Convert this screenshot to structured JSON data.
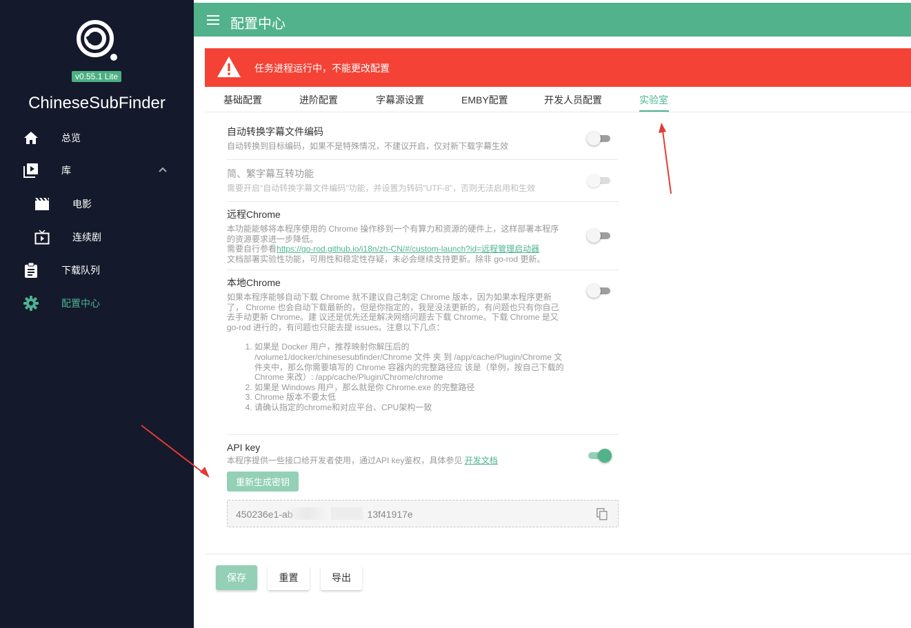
{
  "sidebar": {
    "version": "v0.55.1 Lite",
    "app_name": "ChineseSubFinder",
    "items": [
      {
        "label": "总览",
        "icon": "home-icon"
      },
      {
        "label": "库",
        "icon": "library-icon"
      },
      {
        "label": "电影",
        "icon": "movie-icon"
      },
      {
        "label": "连续剧",
        "icon": "tv-icon"
      },
      {
        "label": "下载队列",
        "icon": "clipboard-icon"
      },
      {
        "label": "配置中心",
        "icon": "gear-icon"
      }
    ],
    "active_color": "#4db393",
    "background": "#141a2b"
  },
  "header": {
    "title": "配置中心",
    "color": "#52b28b"
  },
  "alert": {
    "text": "任务进程运行中，不能更改配置",
    "color": "#f44336"
  },
  "tabs": [
    {
      "label": "基础配置"
    },
    {
      "label": "进阶配置"
    },
    {
      "label": "字幕源设置"
    },
    {
      "label": "EMBY配置"
    },
    {
      "label": "开发人员配置"
    },
    {
      "label": "实验室",
      "active": true
    }
  ],
  "settings": {
    "auto_convert": {
      "title": "自动转换字幕文件编码",
      "desc": "自动转换到目标编码，如果不是特殊情况，不建议开启，仅对新下载字幕生效",
      "enabled": false
    },
    "simplified_traditional": {
      "title": "简、繁字幕互转功能",
      "desc": "需要开启\"自动转换字幕文件编码\"功能，并设置为转码\"UTF-8\"，否则无法启用和生效",
      "enabled": false,
      "disabled": true
    },
    "remote_chrome": {
      "title": "远程Chrome",
      "desc1": "本功能能够将本程序使用的 Chrome 操作移到一个有算力和资源的硬件上，这样部署本程序的资源要求进一步降低。",
      "desc2_prefix": "需要自行参看",
      "desc2_link": "https://go-rod.github.io/i18n/zh-CN/#/custom-launch?id=远程管理启动器",
      "desc3": "文档部署实验性功能，可用性和稳定性存疑，未必会继续支持更新。除非 go-rod 更新。",
      "enabled": false
    },
    "local_chrome": {
      "title": "本地Chrome",
      "desc": "如果本程序能够自动下载 Chrome 就不建议自己制定 Chrome 版本，因为如果本程序更新了， Chrome 也会自动下载最新的，但是你指定的，我是没法更新的，有问题也只有你自己去手动更新 Chrome。建 议还是优先还是解决网络问题去下载 Chrome。下载 Chrome 是又 go-rod 进行的，有问题也只能去提 issues。注意以下几点：",
      "steps": [
        "如果是 Docker 用户，推荐映射你解压后的 /volume1/docker/chinesesubfinder/Chrome 文件 夹 到 /app/cache/Plugin/Chrome 文件夹中，那么你需要填写的 Chrome 容器内的完整路径应 该是（举例，按自己下载的 Chrome 来改）: /app/cache/Plugin/Chrome/chrome",
        "如果是 Windows 用户，那么就是你 Chrome.exe 的完整路径",
        "Chrome 版本不要太低",
        "请确认指定的chrome和对应平台、CPU架构一致"
      ],
      "enabled": false
    },
    "api_key": {
      "title": "API key",
      "desc_prefix": "本程序提供一些接口给开发者使用，通过API key鉴权，具体参见",
      "desc_link": "开发文档",
      "enabled": true,
      "regen_label": "重新生成密钥",
      "key_start": "450236e1-ab",
      "key_end": "13f41917e"
    }
  },
  "footer": {
    "save": "保存",
    "reset": "重置",
    "export": "导出"
  }
}
